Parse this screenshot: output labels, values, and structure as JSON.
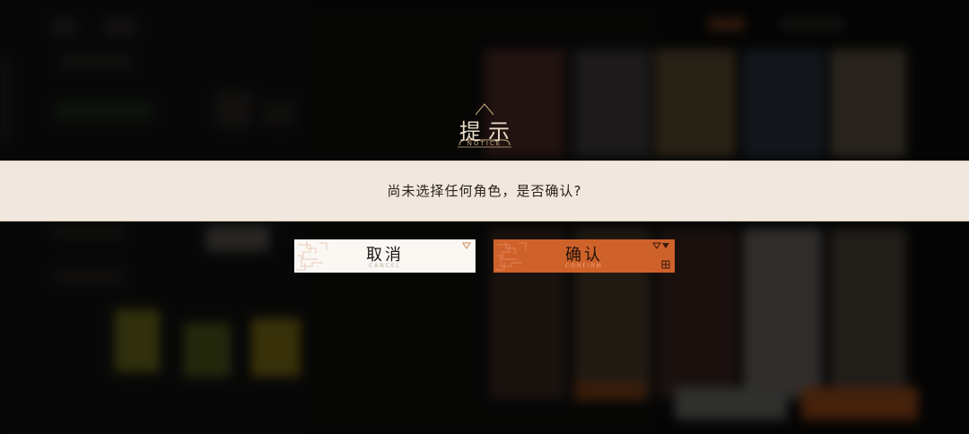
{
  "dialog": {
    "title": "提示",
    "subtitle": "NOTICE",
    "message": "尚未选择任何角色，是否确认?",
    "cancel_label": "取消",
    "cancel_sub": "CANCEL",
    "confirm_label": "确认",
    "confirm_sub": "CONFIRM"
  },
  "colors": {
    "band": "#f1e7df",
    "cancel_bg": "#fbf8f3",
    "confirm_bg": "#cf622a",
    "gold": "#c9ad7f"
  }
}
